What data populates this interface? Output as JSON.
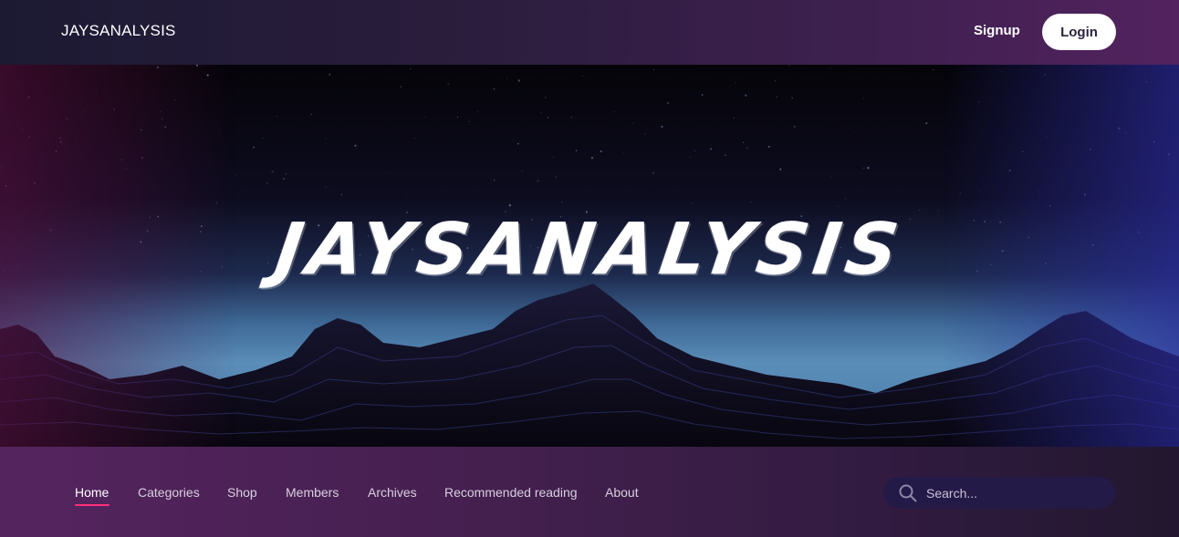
{
  "header": {
    "brand": "JAYSANALYSIS",
    "signup_label": "Signup",
    "login_label": "Login"
  },
  "hero": {
    "title": "JAYSANALYSIS"
  },
  "nav": {
    "items": [
      {
        "label": "Home",
        "active": true
      },
      {
        "label": "Categories"
      },
      {
        "label": "Shop"
      },
      {
        "label": "Members"
      },
      {
        "label": "Archives"
      },
      {
        "label": "Recommended reading"
      },
      {
        "label": "About"
      }
    ],
    "search": {
      "placeholder": "Search...",
      "icon": "search-icon"
    }
  },
  "colors": {
    "accent": "#ff2f7a",
    "header_start": "#1c1a33",
    "header_end": "#53225f",
    "search_bg": "#241a48"
  }
}
